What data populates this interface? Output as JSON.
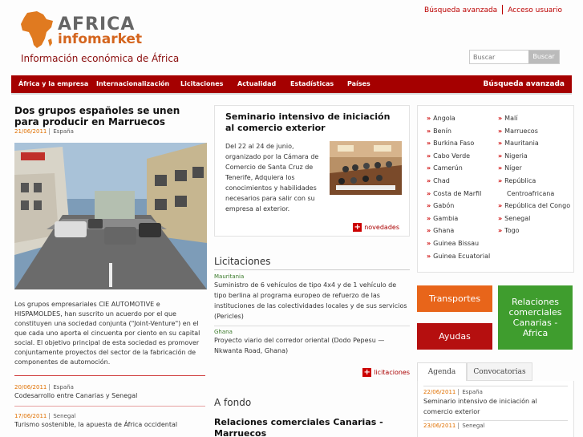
{
  "header": {
    "logo_word1": "AFRICA",
    "logo_word2": "infomarket",
    "tagline": "Información económica de África",
    "links": [
      "Búsqueda avanzada",
      "Acceso usuario"
    ]
  },
  "search": {
    "placeholder": "Buscar",
    "button": "Buscar"
  },
  "nav": {
    "items": [
      "África y la empresa",
      "Internacionalización",
      "Licitaciones",
      "Actualidad",
      "Estadísticas",
      "Países"
    ],
    "advanced": "Búsqueda avanzada"
  },
  "main_article": {
    "title": "Dos grupos españoles se unen para producir en Marruecos",
    "date": "21/06/2011",
    "category": "España",
    "body": "Los grupos empresariales CIE AUTOMOTIVE e HISPAMOLDES, han suscrito un acuerdo por el que constituyen una sociedad conjunta (\"Joint-Venture\") en el que cada uno aporta el cincuenta por ciento en su capital social. El objetivo principal de esta sociedad es promover conjuntamente proyectos del sector de la fabricación de componentes de automoción."
  },
  "news": [
    {
      "date": "20/06/2011",
      "category": "España",
      "title": "Codesarrollo entre Canarias y Senegal"
    },
    {
      "date": "17/06/2011",
      "category": "Senegal",
      "title": "Turismo sostenible, la apuesta de África occidental"
    }
  ],
  "seminar": {
    "title": "Seminario intensivo de iniciación al comercio exterior",
    "text": "Del 22 al 24 de junio, organizado por la Cámara de Comercio de Santa Cruz de Tenerife, Adquiera los conocimientos y habilidades necesarios para salir con su empresa al exterior.",
    "more": "novedades"
  },
  "licitaciones": {
    "heading": "Licitaciones",
    "items": [
      {
        "country": "Mauritania",
        "text": "Suministro de 6 vehículos de tipo 4x4 y de 1 vehículo de tipo berlina al programa europeo de refuerzo de las instituciones de las colectividades locales y de sus servicios (Pericles)"
      },
      {
        "country": "Ghana",
        "text": "Proyecto viario del corredor oriental (Dodo Pepesu — Nkwanta Road, Ghana)"
      }
    ],
    "more": "licitaciones"
  },
  "afondo": {
    "heading": "A fondo",
    "title": "Relaciones comerciales Canarias - Marruecos"
  },
  "countries_left": [
    "Angola",
    "Benín",
    "Burkina Faso",
    "Cabo Verde",
    "Camerún",
    "Chad",
    "Costa de Marfil",
    "Gabón",
    "Gambia",
    "Ghana",
    "Guinea Bissau",
    "Guinea Ecuatorial"
  ],
  "countries_right": [
    "Malí",
    "Marruecos",
    "Mauritania",
    "Nigeria",
    "Níger",
    "República Centroafricana",
    "República del Congo",
    "Senegal",
    "Togo"
  ],
  "boxes": {
    "transportes": "Transportes",
    "relaciones": "Relaciones comerciales Canarias - Africa",
    "ayudas": "Ayudas"
  },
  "tabs": {
    "agenda": "Agenda",
    "convocatorias": "Convocatorias",
    "items": [
      {
        "date": "22/06/2011",
        "category": "España",
        "title": "Seminario intensivo de iniciación al comercio exterior"
      },
      {
        "date": "23/06/2011",
        "category": "Senegal",
        "title": ""
      }
    ]
  },
  "colors": {
    "brand_red": "#a50000",
    "orange": "#e8651a",
    "green": "#3f9d2e",
    "red_box": "#b50f0f"
  }
}
